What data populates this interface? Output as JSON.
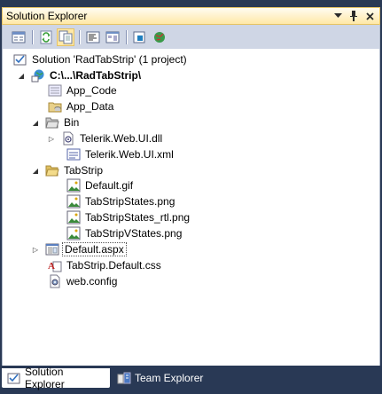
{
  "window": {
    "title": "Solution Explorer",
    "controls": [
      "dropdown-icon",
      "pin-icon",
      "close-icon"
    ]
  },
  "toolbar": {
    "buttons": [
      {
        "name": "properties-button",
        "icon": "properties-icon"
      },
      {
        "name": "refresh-button",
        "icon": "refresh-icon"
      },
      {
        "name": "show-all-files-button",
        "icon": "show-all-files-icon",
        "pressed": true
      },
      {
        "name": "view-code-button",
        "icon": "view-code-icon"
      },
      {
        "name": "view-designer-button",
        "icon": "view-designer-icon"
      },
      {
        "name": "nest-related-files-button",
        "icon": "nest-files-icon"
      },
      {
        "name": "copy-website-button",
        "icon": "copy-website-icon"
      }
    ]
  },
  "tree": {
    "solution": "Solution 'RadTabStrip' (1 project)",
    "project": "C:\\...\\RadTabStrip\\",
    "items": {
      "app_code": "App_Code",
      "app_data": "App_Data",
      "bin": "Bin",
      "telerik_dll": "Telerik.Web.UI.dll",
      "telerik_xml": "Telerik.Web.UI.xml",
      "tabstrip": "TabStrip",
      "default_gif": "Default.gif",
      "states_png": "TabStripStates.png",
      "states_rtl_png": "TabStripStates_rtl.png",
      "vstates_png": "TabStripVStates.png",
      "default_aspx": "Default.aspx",
      "default_css": "TabStrip.Default.css",
      "web_config": "web.config"
    }
  },
  "tabs": {
    "solution_explorer": "Solution Explorer",
    "team_explorer": "Team Explorer"
  },
  "colors": {
    "chrome": "#293955",
    "title_active": "#ffe8a6",
    "toolbar": "#cfd6e5"
  }
}
